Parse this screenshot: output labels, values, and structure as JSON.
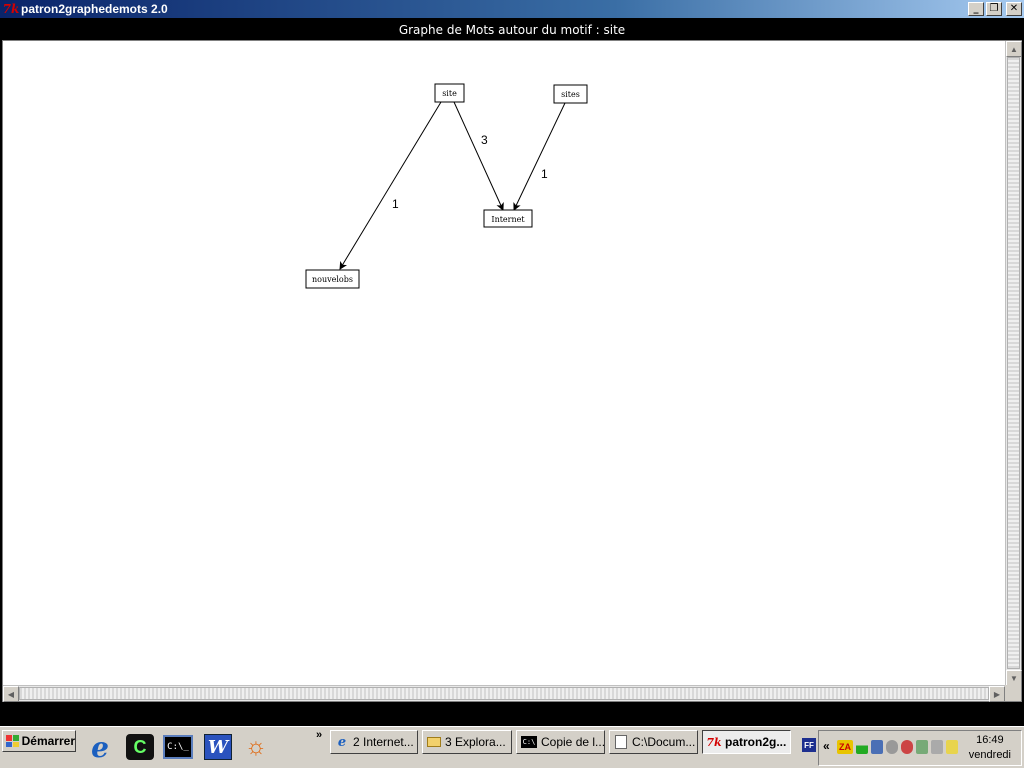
{
  "window": {
    "title": "patron2graphedemots 2.0",
    "controls": {
      "minimize": "_",
      "maximize": "❐",
      "close": "✕"
    }
  },
  "header": {
    "text": "Graphe de Mots autour du motif : site"
  },
  "graph": {
    "nodes": [
      {
        "id": "site",
        "label": "site"
      },
      {
        "id": "sites",
        "label": "sites"
      },
      {
        "id": "internet",
        "label": "Internet"
      },
      {
        "id": "nouvelobs",
        "label": "nouvelobs"
      }
    ],
    "edges": [
      {
        "from": "site",
        "to": "nouvelobs",
        "weight": "1"
      },
      {
        "from": "site",
        "to": "internet",
        "weight": "3"
      },
      {
        "from": "sites",
        "to": "internet",
        "weight": "1"
      }
    ]
  },
  "taskbar": {
    "start_label": "Démarrer",
    "quick_launch_more": "»",
    "tasks": [
      {
        "label": "2 Internet...",
        "icon": "ie-icon",
        "dropdown": true
      },
      {
        "label": "3 Explora...",
        "icon": "folder-icon",
        "dropdown": true
      },
      {
        "label": "Copie de l...",
        "icon": "cmd-icon",
        "dropdown": false
      },
      {
        "label": "C:\\Docum...",
        "icon": "notepad-icon",
        "dropdown": false
      },
      {
        "label": "patron2g...",
        "icon": "tk-icon",
        "dropdown": false,
        "active": true
      }
    ],
    "tray": {
      "ff_label": "FF",
      "chevron": "«",
      "za_label": "ZA",
      "time": "16:49",
      "day": "vendredi"
    }
  }
}
